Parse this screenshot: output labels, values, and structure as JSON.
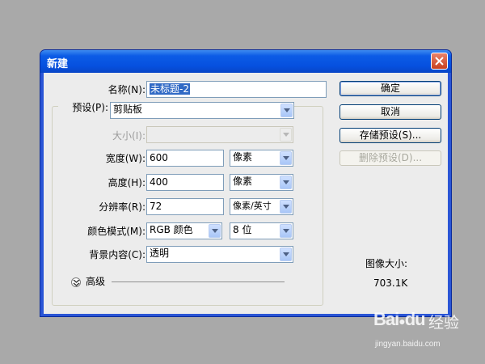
{
  "window": {
    "title": "新建",
    "close_icon": "close-icon"
  },
  "form": {
    "name_label": "名称(N):",
    "name_value": "未标题-2",
    "preset_label": "预设(P):",
    "preset_value": "剪贴板",
    "size_label": "大小(I):",
    "size_value": "",
    "width_label": "宽度(W):",
    "width_value": "600",
    "width_unit": "像素",
    "height_label": "高度(H):",
    "height_value": "400",
    "height_unit": "像素",
    "resolution_label": "分辨率(R):",
    "resolution_value": "72",
    "resolution_unit": "像素/英寸",
    "colormode_label": "颜色模式(M):",
    "colormode_value": "RGB 颜色",
    "bitdepth_value": "8 位",
    "background_label": "背景内容(C):",
    "background_value": "透明",
    "advanced_label": "高级"
  },
  "buttons": {
    "ok": "确定",
    "cancel": "取消",
    "save_preset": "存储预设(S)...",
    "delete_preset": "删除预设(D)..."
  },
  "image_size": {
    "label": "图像大小:",
    "value": "703.1K"
  },
  "watermark": {
    "brand": "Bai",
    "brand_suffix": "du",
    "jingyan": "经验",
    "url": "jingyan.baidu.com"
  },
  "colors": {
    "titlebar": "#0650df",
    "selection": "#316ac5",
    "close_button": "#c8411f",
    "dialog_bg": "#ececec"
  }
}
